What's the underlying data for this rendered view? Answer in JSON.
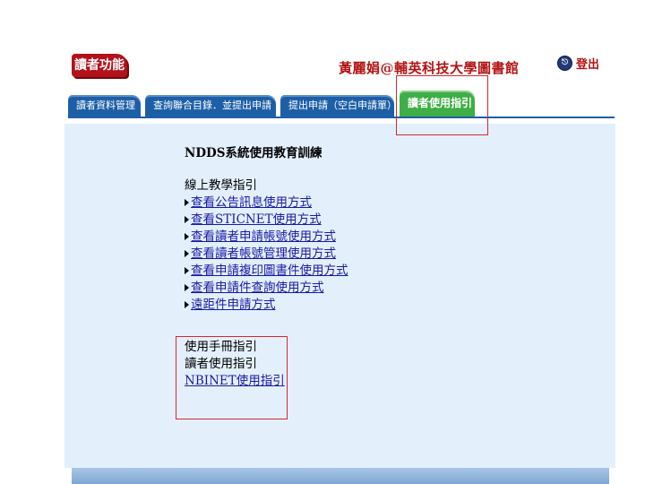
{
  "header": {
    "function_label": "讀者功能",
    "library_title": "黃麗娟@輔英科技大學圖書館",
    "logout_label": "登出",
    "logout_icon": "logout-icon"
  },
  "tabs": [
    {
      "label": "讀者資料管理",
      "active": false
    },
    {
      "label": "查詢聯合目錄．並提出申請",
      "active": false
    },
    {
      "label": "提出申請（空白申請單）",
      "active": false
    },
    {
      "label": "讀者使用指引",
      "active": true
    }
  ],
  "main": {
    "heading": "NDDS系統使用教育訓練",
    "online_section": {
      "title": "線上教學指引",
      "links": [
        "查看公告訊息使用方式",
        "查看STICNET使用方式",
        "查看讀者申請帳號使用方式",
        "查看讀者帳號管理使用方式",
        "查看申請複印圖書件使用方式",
        "查看申請件查詢使用方式",
        "遠距件申請方式"
      ]
    },
    "manual_section": {
      "title": "使用手冊指引",
      "items": [
        "讀者使用指引",
        "NBINET使用指引"
      ]
    }
  },
  "colors": {
    "accent_red": "#b31313",
    "tab_blue": "#1d5fa6",
    "tab_active_green": "#3fae46",
    "panel_bg": "#e3f0fb",
    "highlight": "#d1292f"
  }
}
